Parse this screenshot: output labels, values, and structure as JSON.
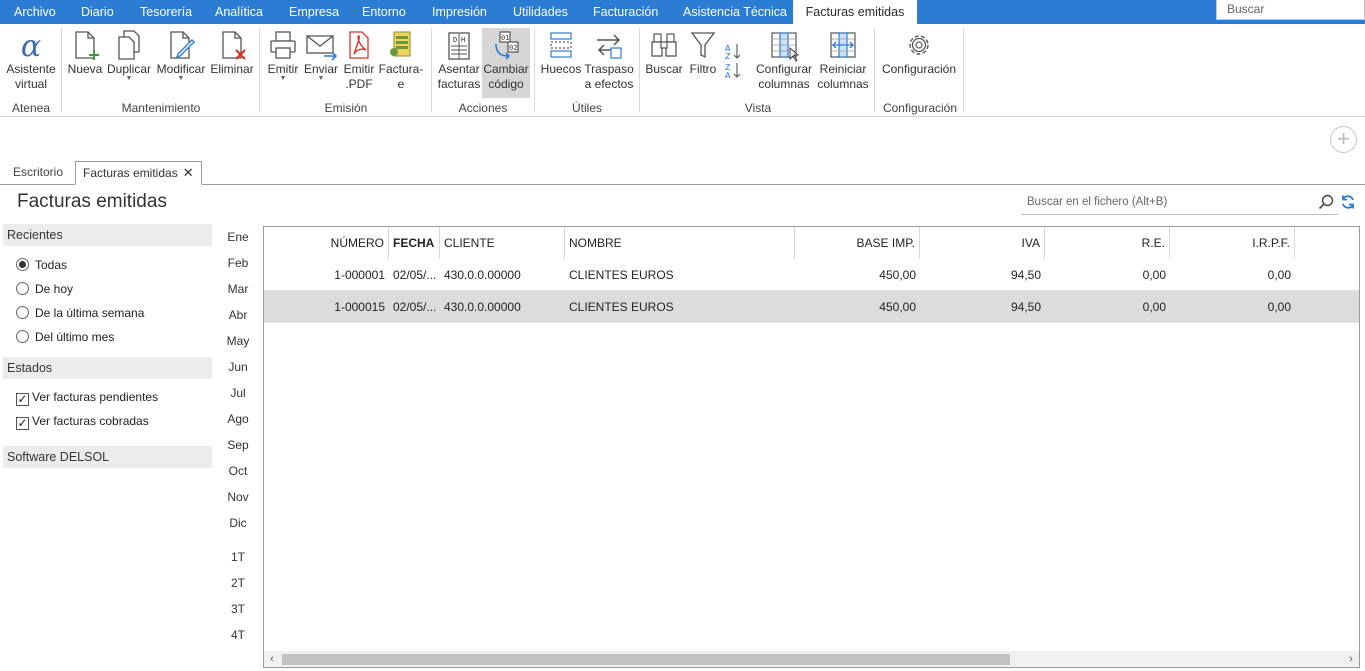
{
  "menu": {
    "items": [
      "Archivo",
      "Diario",
      "Tesorería",
      "Analítica",
      "Empresa",
      "Entorno",
      "Impresión",
      "Utilidades",
      "Facturación",
      "Asistencia Técnica"
    ],
    "active": "Facturas emitidas",
    "search_placeholder": "Buscar"
  },
  "ribbon": {
    "asistente": "Asistente\nvirtual",
    "nueva": "Nueva",
    "duplicar": "Duplicar",
    "modificar": "Modificar",
    "eliminar": "Eliminar",
    "emitir": "Emitir",
    "enviar": "Enviar",
    "emitir_pdf": "Emitir\n.PDF",
    "facturae": "Factura-\ne",
    "asentar": "Asentar\nfacturas",
    "cambiar": "Cambiar\ncódigo",
    "huecos": "Huecos",
    "traspaso": "Traspaso\na efectos",
    "buscar": "Buscar",
    "filtro": "Filtro",
    "configurar": "Configurar\ncolumnas",
    "reiniciar": "Reiniciar\ncolumnas",
    "configuracion": "Configuración",
    "groups": {
      "atenea": "Atenea",
      "mantenimiento": "Mantenimiento",
      "emision": "Emisión",
      "acciones": "Acciones",
      "utiles": "Útiles",
      "vista": "Vista",
      "configuracion": "Configuración"
    }
  },
  "tabs": {
    "escritorio": "Escritorio",
    "facturas": "Facturas emitidas",
    "close": "✕"
  },
  "page": {
    "title": "Facturas emitidas",
    "search_placeholder": "Buscar en el fichero (Alt+B)"
  },
  "left": {
    "recientes": "Recientes",
    "radios": [
      "Todas",
      "De hoy",
      "De la última semana",
      "Del último mes"
    ],
    "selected_radio": 0,
    "estados": "Estados",
    "checks": [
      "Ver facturas pendientes",
      "Ver facturas cobradas"
    ],
    "software": "Software DELSOL"
  },
  "months": [
    "Ene",
    "Feb",
    "Mar",
    "Abr",
    "May",
    "Jun",
    "Jul",
    "Ago",
    "Sep",
    "Oct",
    "Nov",
    "Dic"
  ],
  "quarters": [
    "1T",
    "2T",
    "3T",
    "4T"
  ],
  "grid": {
    "headers": [
      "NÚMERO",
      "FECHA",
      "CLIENTE",
      "NOMBRE",
      "BASE IMP.",
      "IVA",
      "R.E.",
      "I.R.P.F."
    ],
    "rows": [
      [
        "1-000001",
        "02/05/...",
        "430.0.0.00000",
        "CLIENTES EUROS",
        "450,00",
        "94,50",
        "0,00",
        "0,00"
      ],
      [
        "1-000015",
        "02/05/...",
        "430.0.0.00000",
        "CLIENTES EUROS",
        "450,00",
        "94,50",
        "0,00",
        "0,00"
      ]
    ],
    "selected_row": 1
  },
  "colors": {
    "menubar": "#2b7cd3",
    "accent_icon": "#2b7cd3",
    "danger": "#d9342b",
    "success": "#3a9a3a"
  }
}
